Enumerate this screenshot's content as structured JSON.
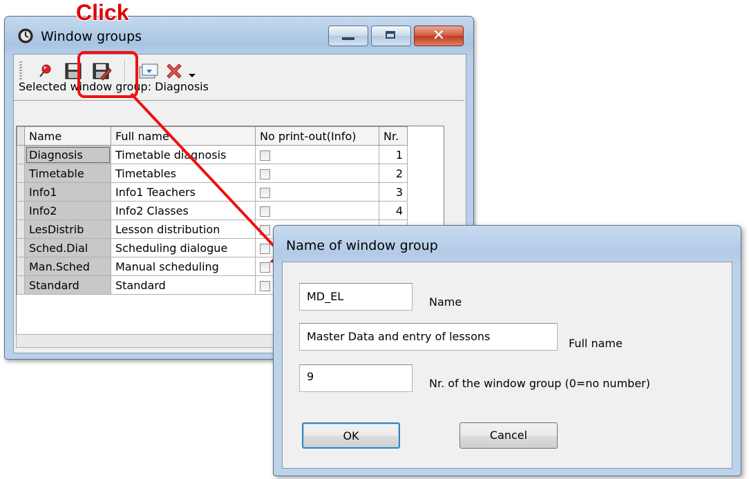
{
  "annotation": {
    "click_label": "Click"
  },
  "window": {
    "title": "Window groups",
    "selected_label": "Selected window group: Diagnosis",
    "table": {
      "headers": [
        "Name",
        "Full name",
        "No print-out(Info)",
        "Nr."
      ],
      "rows": [
        {
          "name": "Diagnosis",
          "full_name": "Timetable diagnosis",
          "nr": "1"
        },
        {
          "name": "Timetable",
          "full_name": "Timetables",
          "nr": "2"
        },
        {
          "name": "Info1",
          "full_name": "Info1 Teachers",
          "nr": "3"
        },
        {
          "name": "Info2",
          "full_name": "Info2 Classes",
          "nr": "4"
        },
        {
          "name": "LesDistrib",
          "full_name": "Lesson distribution",
          "nr": ""
        },
        {
          "name": "Sched.Dial",
          "full_name": "Scheduling dialogue",
          "nr": ""
        },
        {
          "name": "Man.Sched",
          "full_name": "Manual scheduling",
          "nr": ""
        },
        {
          "name": "Standard",
          "full_name": "Standard",
          "nr": ""
        }
      ]
    },
    "toolbar_icons": [
      "pin-icon",
      "save-icon",
      "save-as-icon",
      "import-icon",
      "delete-icon",
      "dropdown-arrow-icon"
    ]
  },
  "dialog": {
    "title": "Name of window group",
    "name_value": "MD_EL",
    "name_label": "Name",
    "full_name_value": "Master Data and entry of lessons",
    "full_name_label": "Full name",
    "nr_value": "9",
    "nr_label": "Nr. of the window group (0=no number)",
    "ok_label": "OK",
    "cancel_label": "Cancel"
  },
  "colors": {
    "annotation_red": "#e00000",
    "title_bar": "#b9d0ea"
  }
}
